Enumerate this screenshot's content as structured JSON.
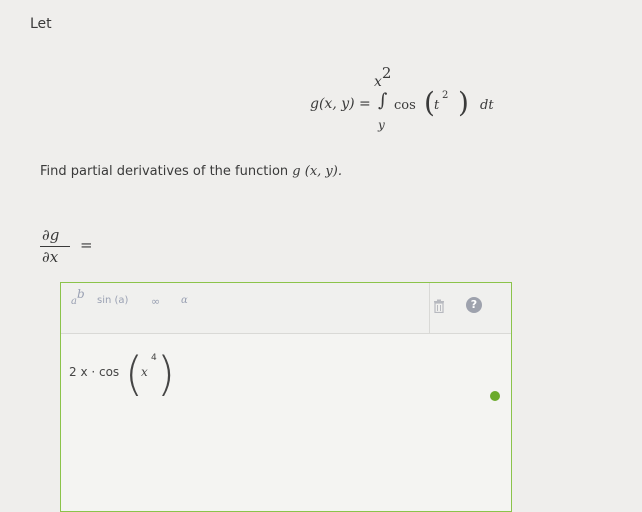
{
  "header": {
    "let": "Let"
  },
  "definition": {
    "lhs": "g(x, y) =",
    "upper_base": "x",
    "upper_exp": "2",
    "integral": "∫",
    "lower": "y",
    "cos": "cos",
    "t": "t",
    "t_exp": "2",
    "dt": "dt"
  },
  "question": {
    "text": "Find partial derivatives of the function",
    "fn": "g (x, y)."
  },
  "derivative_label": {
    "numer": "∂g",
    "denom": "∂x",
    "eq": "="
  },
  "toolbar": {
    "power_base": "a",
    "power_exp": "b",
    "sin": "sin (a)",
    "infinity": "∞",
    "alpha": "α",
    "trash": "🗑",
    "help": "?"
  },
  "answer": {
    "prefix": "2 x · cos",
    "x": "x",
    "exp": "4"
  },
  "status": {
    "color": "#6aaa2b"
  }
}
